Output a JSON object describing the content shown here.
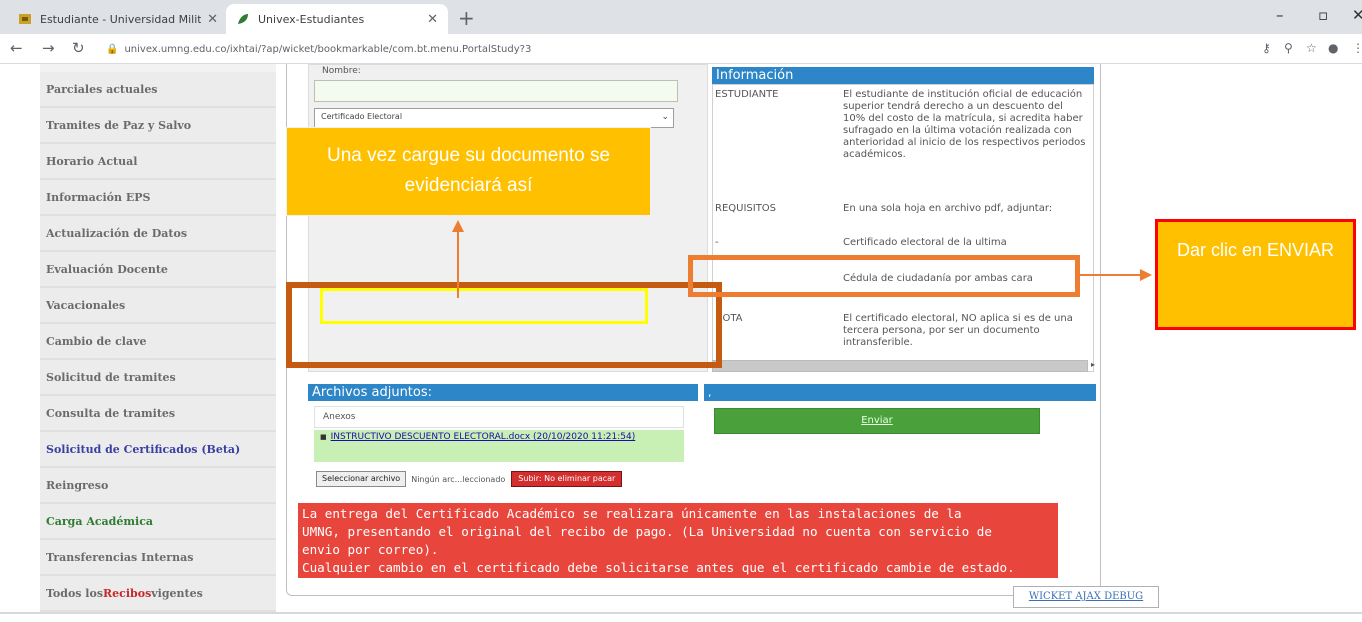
{
  "browser": {
    "tabs": [
      {
        "title": "Estudiante - Universidad Milita",
        "active": false
      },
      {
        "title": "Univex-Estudiantes",
        "active": true
      }
    ],
    "url": "univex.umng.edu.co/ixhtai/?ap/wicket/bookmarkable/com.bt.menu.PortalStudy?3"
  },
  "sidebar": {
    "items": [
      {
        "label": "Parciales actuales",
        "style": "normal"
      },
      {
        "label": "Tramites de Paz y Salvo",
        "style": "normal"
      },
      {
        "label": "Horario Actual",
        "style": "normal"
      },
      {
        "label": "Información EPS",
        "style": "normal"
      },
      {
        "label": "Actualización de Datos",
        "style": "normal"
      },
      {
        "label": "Evaluación Docente",
        "style": "normal"
      },
      {
        "label": "Vacacionales",
        "style": "normal"
      },
      {
        "label": "Cambio de clave",
        "style": "normal"
      },
      {
        "label": "Solicitud de tramites",
        "style": "normal"
      },
      {
        "label": "Consulta de tramites",
        "style": "normal"
      },
      {
        "label": "Solicitud de Certificados (Beta)",
        "style": "blue"
      },
      {
        "label": "Reingreso",
        "style": "normal"
      },
      {
        "label": "Carga Académica",
        "style": "green"
      },
      {
        "label": "Transferencias Internas",
        "style": "normal"
      }
    ],
    "last_item": {
      "prefix": "Todos los ",
      "highlight": "Recibos",
      "suffix": " vigentes"
    }
  },
  "form": {
    "nombre_label": "Nombre:",
    "nombre_value": "",
    "cert_select_value": "Certificado Electoral"
  },
  "info": {
    "title": "Información",
    "rows": [
      {
        "key": "ESTUDIANTE",
        "value": "El estudiante de institución oficial de educación superior tendrá derecho a un descuento del 10% del costo de la matrícula, si acredita haber sufragado en la última votación realizada con anterioridad al inicio de los respectivos periodos académicos."
      },
      {
        "key": "REQUISITOS",
        "value": "En una sola hoja en archivo pdf, adjuntar:"
      },
      {
        "key": "-",
        "value": "Certificado electoral de la ultima"
      },
      {
        "key": "",
        "value": "Cédula de ciudadanía por ambas cara"
      },
      {
        "key": "NOTA",
        "value": "El certificado electoral, NO aplica si es de una tercera persona, por ser un documento intransferible."
      }
    ]
  },
  "attachments": {
    "title": "Archivos adjuntos:",
    "right_title": ",",
    "list_header": "Anexos",
    "file_link": "INSTRUCTIVO DESCUENTO ELECTORAL.docx (20/10/2020 11:21:54)",
    "select_button": "Seleccionar archivo",
    "no_file_text": "Ningún arc...leccionado",
    "upload_button": "Subir: No eliminar pacar"
  },
  "enviar_label": "Enviar",
  "notice_lines": [
    "La entrega del Certificado Académico se realizara únicamente en las instalaciones de la",
    "UMNG, presentando el original del recibo de pago. (La Universidad no cuenta con servicio de",
    "envio por correo).",
    "Cualquier cambio en el certificado debe solicitarse antes que el certificado cambie de estado."
  ],
  "debug_label": "WICKET AJAX DEBUG",
  "annotations": {
    "callout_left": "Una vez cargue su documento se evidenciará así",
    "callout_right": "Dar clic en ENVIAR"
  },
  "colors": {
    "section_header_blue": "#2d86c7",
    "notice_red": "#e8453c",
    "enviar_green": "#4aa13c",
    "callout_fill": "#ffc000",
    "box_brown": "#c55a11",
    "box_orange": "#ed7d31",
    "box_yellow": "#ffff00"
  }
}
